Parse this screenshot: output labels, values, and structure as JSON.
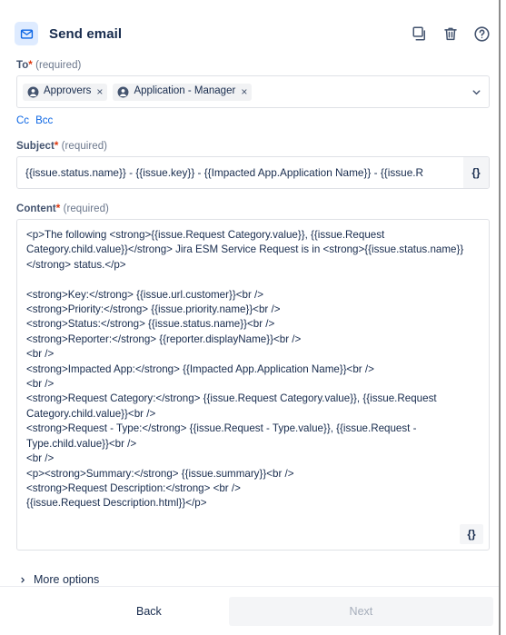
{
  "header": {
    "title": "Send email",
    "mail_icon": "mail-icon",
    "actions": [
      {
        "name": "copy-icon",
        "label": "Copy"
      },
      {
        "name": "trash-icon",
        "label": "Delete"
      },
      {
        "name": "help-icon",
        "label": "Help"
      }
    ]
  },
  "to_field": {
    "label": "To",
    "required_star": "*",
    "required_note": "(required)",
    "chips": [
      {
        "label": "Approvers",
        "remove": "×",
        "avatar": "person-avatar-icon"
      },
      {
        "label": "Application - Manager",
        "remove": "×",
        "avatar": "person-avatar-icon"
      }
    ],
    "dropdown_icon": "chevron-down-icon"
  },
  "cc_bcc": {
    "cc": "Cc",
    "bcc": "Bcc"
  },
  "subject_field": {
    "label": "Subject",
    "required_star": "*",
    "required_note": "(required)",
    "value": "{{issue.status.name}} - {{issue.key}} - {{Impacted App.Application Name}} - {{issue.R",
    "smart_values_button": "{}"
  },
  "content_field": {
    "label": "Content",
    "required_star": "*",
    "required_note": "(required)",
    "value": "<p>The following <strong>{{issue.Request Category.value}}, {{issue.Request Category.child.value}}</strong> Jira ESM Service Request is in <strong>{{issue.status.name}}</strong> status.</p>\n\n<strong>Key:</strong> {{issue.url.customer}}<br />\n<strong>Priority:</strong> {{issue.priority.name}}<br />\n<strong>Status:</strong> {{issue.status.name}}<br />\n<strong>Reporter:</strong> {{reporter.displayName}}<br />\n<br />\n<strong>Impacted App:</strong> {{Impacted App.Application Name}}<br />\n<br />\n<strong>Request Category:</strong> {{issue.Request Category.value}}, {{issue.Request Category.child.value}}<br />\n<strong>Request - Type:</strong> {{issue.Request - Type.value}}, {{issue.Request - Type.child.value}}<br />\n<br />\n<p><strong>Summary:</strong> {{issue.summary}}<br />\n<strong>Request Description:</strong> <br />\n{{issue.Request Description.html}}</p>",
    "smart_values_button": "{}"
  },
  "more_options": {
    "label": "More options",
    "icon": "chevron-right-icon"
  },
  "footer": {
    "back_label": "Back",
    "next_label": "Next"
  },
  "colors": {
    "accent_blue": "#0c66e4",
    "mail_badge_bg": "#deebff",
    "required_red": "#de350b",
    "text_primary": "#172b4d",
    "text_muted": "#6b778c",
    "border": "#dfe1e6",
    "chip_bg": "#f1f2f4",
    "disabled_bg": "#f4f5f7",
    "disabled_text": "#a5adba"
  }
}
